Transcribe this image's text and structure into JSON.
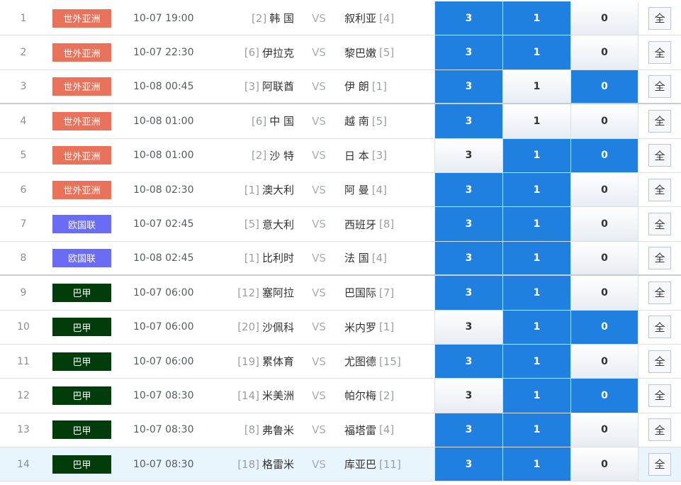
{
  "colors": {
    "league_asia": "#e8735a",
    "league_euro": "#6b6cf6",
    "league_brazil": "#003d0b",
    "selected": "#1f80e0"
  },
  "all_label": "全",
  "vs_label": "VS",
  "options": [
    "3",
    "1",
    "0"
  ],
  "matches": [
    {
      "no": "1",
      "league": "世外亚洲",
      "league_color": "#e8735a",
      "time": "10-07 19:00",
      "home_rank": "[2]",
      "home": "韩 国",
      "away": "叙利亚",
      "away_rank": "[4]",
      "sel": [
        true,
        true,
        false
      ]
    },
    {
      "no": "2",
      "league": "世外亚洲",
      "league_color": "#e8735a",
      "time": "10-07 22:30",
      "home_rank": "[6]",
      "home": "伊拉克",
      "away": "黎巴嫩",
      "away_rank": "[5]",
      "sel": [
        true,
        true,
        false
      ]
    },
    {
      "no": "3",
      "league": "世外亚洲",
      "league_color": "#e8735a",
      "time": "10-08 00:45",
      "home_rank": "[3]",
      "home": "阿联酋",
      "away": "伊 朗",
      "away_rank": "[1]",
      "sel": [
        true,
        false,
        true
      ]
    },
    {
      "no": "4",
      "league": "世外亚洲",
      "league_color": "#e8735a",
      "time": "10-08 01:00",
      "home_rank": "[6]",
      "home": "中 国",
      "away": "越 南",
      "away_rank": "[5]",
      "sel": [
        true,
        false,
        false
      ]
    },
    {
      "no": "5",
      "league": "世外亚洲",
      "league_color": "#e8735a",
      "time": "10-08 01:00",
      "home_rank": "[2]",
      "home": "沙 特",
      "away": "日 本",
      "away_rank": "[3]",
      "sel": [
        false,
        true,
        true
      ]
    },
    {
      "no": "6",
      "league": "世外亚洲",
      "league_color": "#e8735a",
      "time": "10-08 02:30",
      "home_rank": "[1]",
      "home": "澳大利",
      "away": "阿 曼",
      "away_rank": "[4]",
      "sel": [
        true,
        true,
        false
      ]
    },
    {
      "no": "7",
      "league": "欧国联",
      "league_color": "#6b6cf6",
      "time": "10-07 02:45",
      "home_rank": "[5]",
      "home": "意大利",
      "away": "西班牙",
      "away_rank": "[8]",
      "sel": [
        true,
        true,
        false
      ]
    },
    {
      "no": "8",
      "league": "欧国联",
      "league_color": "#6b6cf6",
      "time": "10-08 02:45",
      "home_rank": "[1]",
      "home": "比利时",
      "away": "法 国",
      "away_rank": "[4]",
      "sel": [
        true,
        true,
        false
      ]
    },
    {
      "no": "9",
      "league": "巴甲",
      "league_color": "#003d0b",
      "time": "10-07 06:00",
      "home_rank": "[12]",
      "home": "塞阿拉",
      "away": "巴国际",
      "away_rank": "[7]",
      "sel": [
        true,
        true,
        false
      ]
    },
    {
      "no": "10",
      "league": "巴甲",
      "league_color": "#003d0b",
      "time": "10-07 06:00",
      "home_rank": "[20]",
      "home": "沙佩科",
      "away": "米内罗",
      "away_rank": "[1]",
      "sel": [
        false,
        true,
        true
      ]
    },
    {
      "no": "11",
      "league": "巴甲",
      "league_color": "#003d0b",
      "time": "10-07 06:00",
      "home_rank": "[19]",
      "home": "累体育",
      "away": "尤图德",
      "away_rank": "[15]",
      "sel": [
        true,
        true,
        false
      ]
    },
    {
      "no": "12",
      "league": "巴甲",
      "league_color": "#003d0b",
      "time": "10-07 08:30",
      "home_rank": "[14]",
      "home": "米美洲",
      "away": "帕尔梅",
      "away_rank": "[2]",
      "sel": [
        false,
        true,
        true
      ]
    },
    {
      "no": "13",
      "league": "巴甲",
      "league_color": "#003d0b",
      "time": "10-07 08:30",
      "home_rank": "[8]",
      "home": "弗鲁米",
      "away": "福塔雷",
      "away_rank": "[4]",
      "sel": [
        true,
        true,
        false
      ]
    },
    {
      "no": "14",
      "league": "巴甲",
      "league_color": "#003d0b",
      "time": "10-07 08:30",
      "home_rank": "[18]",
      "home": "格雷米",
      "away": "库亚巴",
      "away_rank": "[11]",
      "sel": [
        true,
        true,
        false
      ]
    }
  ]
}
